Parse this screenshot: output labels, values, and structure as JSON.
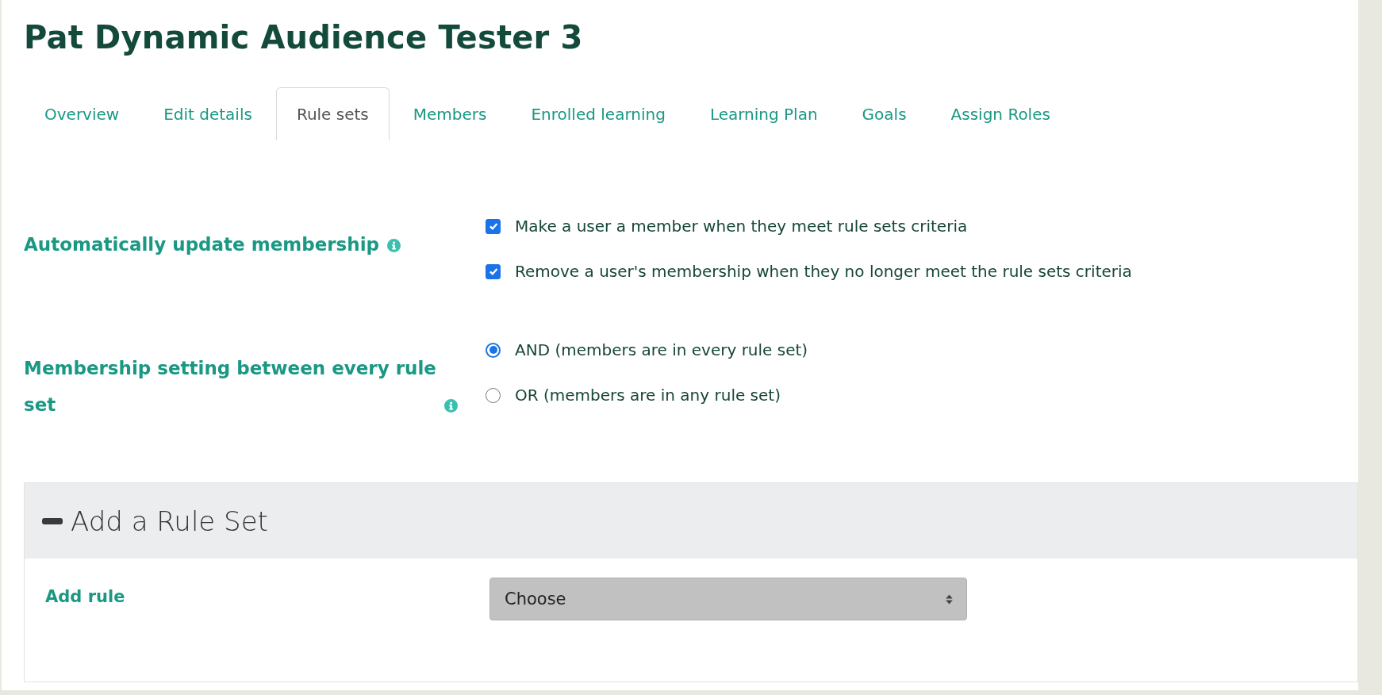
{
  "title": "Pat Dynamic Audience Tester 3",
  "tabs": [
    {
      "label": "Overview",
      "selected": false
    },
    {
      "label": "Edit details",
      "selected": false
    },
    {
      "label": "Rule sets",
      "selected": true
    },
    {
      "label": "Members",
      "selected": false
    },
    {
      "label": "Enrolled learning",
      "selected": false
    },
    {
      "label": "Learning Plan",
      "selected": false
    },
    {
      "label": "Goals",
      "selected": false
    },
    {
      "label": "Assign Roles",
      "selected": false
    }
  ],
  "settings": [
    {
      "label": "Automatically update membership",
      "kind": "checkbox",
      "options": [
        {
          "label": "Make a user a member when they meet rule sets criteria",
          "checked": true
        },
        {
          "label": "Remove a user's membership when they no longer meet the rule sets criteria",
          "checked": true
        }
      ]
    },
    {
      "label": "Membership setting between every rule set",
      "kind": "radio",
      "options": [
        {
          "label": "AND (members are in every rule set)",
          "selected": true
        },
        {
          "label": "OR (members are in any rule set)",
          "selected": false
        }
      ]
    }
  ],
  "rule_set": {
    "title": "Add a Rule Set",
    "expanded": true,
    "field_label": "Add rule",
    "select_value": "Choose"
  }
}
